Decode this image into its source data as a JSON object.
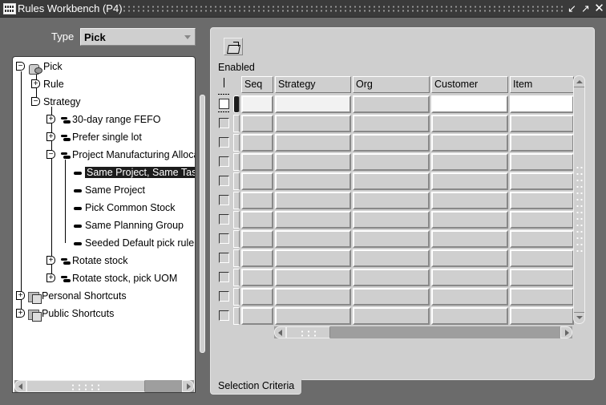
{
  "window": {
    "title": "Rules Workbench (P4)",
    "controls": {
      "minimize": "minimize",
      "maximize": "maximize",
      "close": "close"
    }
  },
  "type_field": {
    "label": "Type",
    "value": "Pick"
  },
  "tree": {
    "root": "Pick",
    "nodes": [
      {
        "label": "Rule",
        "state": "collapsed"
      },
      {
        "label": "Strategy",
        "state": "expanded"
      },
      {
        "label": "30-day range FEFO",
        "state": "collapsed"
      },
      {
        "label": "Prefer single lot",
        "state": "collapsed"
      },
      {
        "label": "Project Manufacturing Allocation",
        "state": "expanded"
      },
      {
        "label": "Same Project, Same Task",
        "selected": true
      },
      {
        "label": "Same Project"
      },
      {
        "label": "Pick Common Stock"
      },
      {
        "label": "Same Planning Group"
      },
      {
        "label": "Seeded Default pick rule"
      },
      {
        "label": "Rotate stock",
        "state": "collapsed"
      },
      {
        "label": "Rotate stock, pick UOM",
        "state": "collapsed"
      },
      {
        "label": "Personal Shortcuts",
        "state": "collapsed"
      },
      {
        "label": "Public Shortcuts",
        "state": "collapsed"
      }
    ]
  },
  "panel": {
    "enabled_label": "Enabled",
    "columns": [
      "Seq",
      "Strategy",
      "Org",
      "Customer",
      "Item"
    ],
    "row_count": 12,
    "tab_label": "Selection Criteria"
  }
}
